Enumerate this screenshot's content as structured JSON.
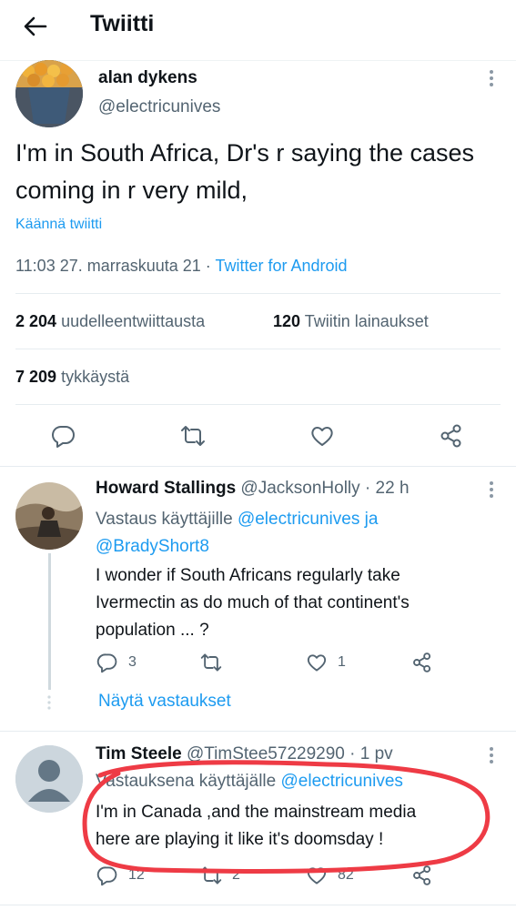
{
  "header": {
    "title": "Twiitti",
    "back_icon": "arrow-left-icon"
  },
  "main_tweet": {
    "display_name": "alan dykens",
    "handle": "@electricunives",
    "text": "I'm in South Africa,  Dr's r saying the cases coming in r very mild,",
    "translate": "Käännä twiitti",
    "time": "11:03 27. marraskuuta 21 · ",
    "source": "Twitter for Android",
    "retweets_count": "2 204",
    "retweets_label": "uudelleentwiittausta",
    "quotes_count": "120",
    "quotes_label": "Twiitin lainaukset",
    "likes_count": "7 209",
    "likes_label": "tykkäystä"
  },
  "replies": [
    {
      "display_name": "Howard Stallings",
      "handle": "@JacksonHolly",
      "time": " · 22 h",
      "reply_prefix": "Vastaus käyttäjille ",
      "reply_to_1": "@electricunives",
      "reply_and": " ja",
      "reply_to_2": "@BradyShort8",
      "text_line1": "I wonder if South Africans regularly take",
      "text_line2": "Ivermectin as do much of that continent's",
      "text_line3": "population ... ?",
      "reply_count": "3",
      "retweet_count": "",
      "like_count": "1",
      "show_replies": "Näytä vastaukset"
    },
    {
      "display_name": "Tim Steele",
      "handle": "@TimStee57229290",
      "time": " · 1 pv",
      "reply_prefix": "Vastauksena käyttäjälle ",
      "reply_to_1": "@electricunives",
      "text_line1": "I'm in Canada ,and the mainstream media",
      "text_line2": "here are playing  it like it's doomsday !",
      "reply_count": "12",
      "retweet_count": "2",
      "like_count": "82"
    }
  ],
  "colors": {
    "accent": "#1d9bf0",
    "muted": "#536471",
    "annotation": "#ee3b45"
  }
}
